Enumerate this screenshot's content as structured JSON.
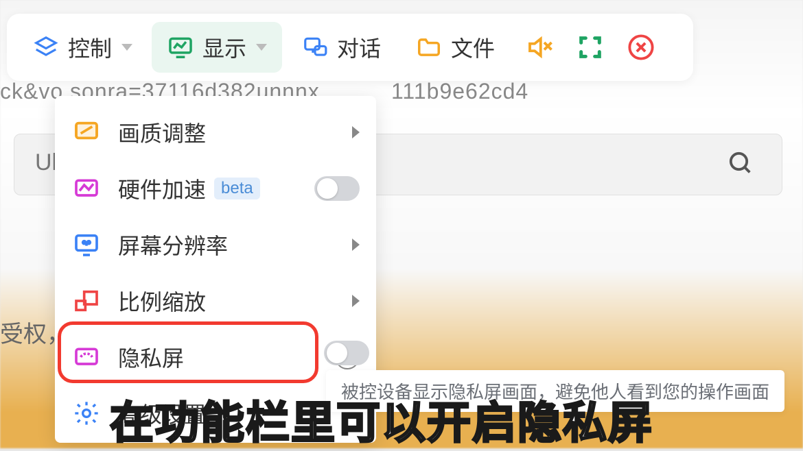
{
  "toolbar": {
    "items": [
      {
        "label": "控制"
      },
      {
        "label": "显示"
      },
      {
        "label": "对话"
      },
      {
        "label": "文件"
      }
    ]
  },
  "bg": {
    "url_left": "ck&vo sonra=37116d382unnnx",
    "url_right": "111b9e62cd4",
    "ul": "Ul",
    "auth": "受权，"
  },
  "dropdown": {
    "items": [
      {
        "label": "画质调整"
      },
      {
        "label": "硬件加速",
        "beta": "beta"
      },
      {
        "label": "屏幕分辨率"
      },
      {
        "label": "比例缩放"
      },
      {
        "label": "隐私屏"
      },
      {
        "label": "高级设置"
      }
    ]
  },
  "tooltip": "被控设备显示隐私屏画面，避免他人看到您的操作画面",
  "caption": "在功能栏里可以开启隐私屏"
}
